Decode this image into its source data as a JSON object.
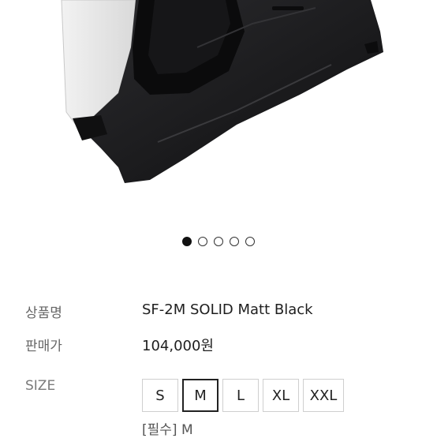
{
  "carousel": {
    "slide_count": 5,
    "active_index": 0
  },
  "product": {
    "name_label": "상품명",
    "name": "SF-2M SOLID Matt Black",
    "price_label": "판매가",
    "price": "104,000원"
  },
  "size": {
    "label": "SIZE",
    "options": [
      "S",
      "M",
      "L",
      "XL",
      "XXL"
    ],
    "selected": "M",
    "required_note": "[필수] M"
  },
  "colors": {
    "helmet": "#1c1c1e",
    "text": "#2a2a2a",
    "muted": "#666666"
  }
}
